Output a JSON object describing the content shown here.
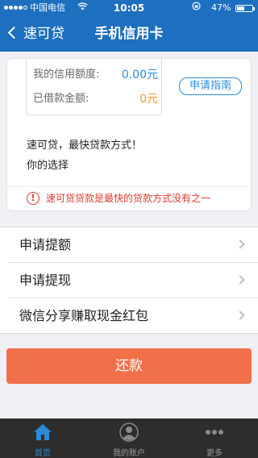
{
  "status_bar": {
    "carrier": "中国电信",
    "time": "10:05",
    "battery": "47%",
    "signal_bars": 4,
    "signal_total": 5
  },
  "nav": {
    "back_label": "速可贷",
    "title": "手机信用卡"
  },
  "credit": {
    "limit_label": "我的信用额度:",
    "limit_value": "0.00元",
    "borrowed_label": "已借款金额:",
    "borrowed_value": "0元",
    "guide_button": "申请指南"
  },
  "intro": {
    "line1": "速可贷，最快贷款方式！",
    "line2": "你的选择"
  },
  "warning": {
    "icon": "exclamation-icon",
    "text": "速可贷贷款是最快的贷款方式没有之一"
  },
  "menu": {
    "items": [
      {
        "label": "申请提额"
      },
      {
        "label": "申请提现"
      },
      {
        "label": "微信分享赚取现金红包"
      }
    ]
  },
  "repay_button": "还款",
  "tabbar": {
    "tabs": [
      {
        "label": "首页",
        "icon": "home-icon",
        "active": true
      },
      {
        "label": "我的账户",
        "icon": "user-icon",
        "active": false
      },
      {
        "label": "更多",
        "icon": "more-icon",
        "active": false
      }
    ]
  },
  "colors": {
    "nav_bg": "#1d6fbf",
    "accent_blue": "#2c8ad8",
    "accent_orange": "#f39a3c",
    "warning_red": "#e03a2f",
    "repay_bg": "#f0704a",
    "tabbar_bg": "#2d2d2d"
  }
}
